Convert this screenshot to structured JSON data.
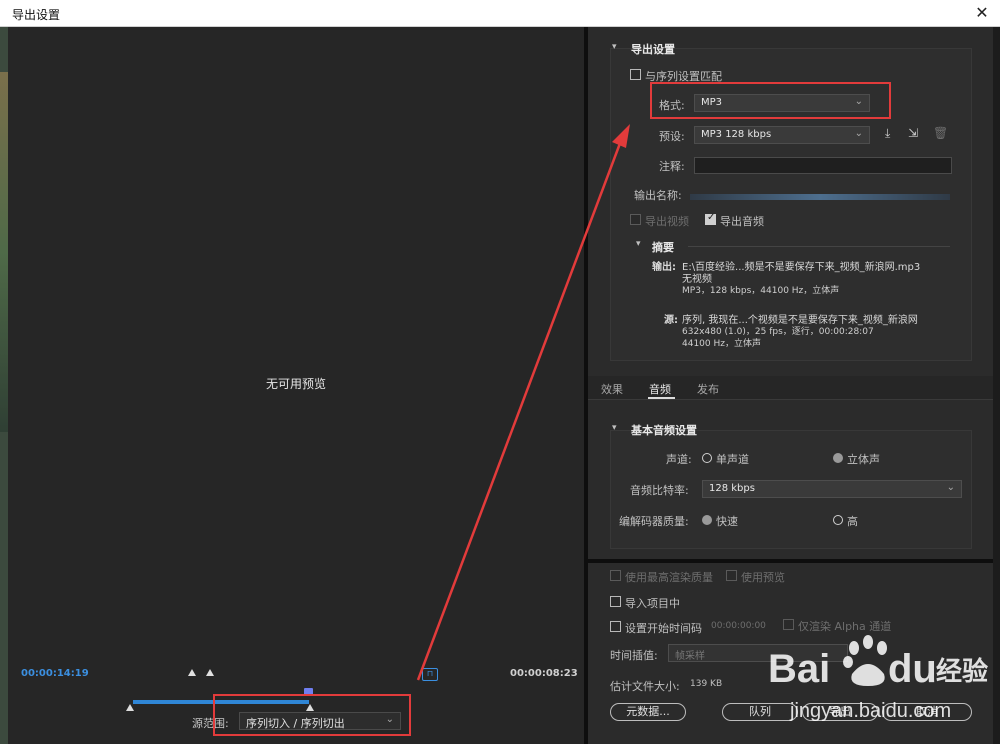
{
  "window": {
    "title": "导出设置",
    "close": "✕"
  },
  "preview": {
    "no_preview": "无可用预览",
    "timecode_in": "00:00:14:19",
    "timecode_out": "00:00:08:23",
    "source_range_label": "源范围:",
    "source_range_value": "序列切入 / 序列切出"
  },
  "export_settings": {
    "heading": "导出设置",
    "match_sequence": "与序列设置匹配",
    "format_label": "格式:",
    "format_value": "MP3",
    "preset_label": "预设:",
    "preset_value": "MP3 128 kbps",
    "comment_label": "注释:",
    "output_name_label": "输出名称:",
    "export_video": "导出视频",
    "export_audio": "导出音频",
    "export_video_checked": false,
    "export_audio_checked": true
  },
  "summary": {
    "heading": "摘要",
    "output_label": "输出:",
    "output_line1": "E:\\百度经验...频是不是要保存下来_视频_新浪网.mp3",
    "output_line2": "无视频",
    "output_line3": "MP3，128 kbps，44100 Hz，立体声",
    "source_label": "源:",
    "source_line1": "序列, 我现在...个视频是不是要保存下来_视频_新浪网",
    "source_line2": "632x480 (1.0)，25 fps，逐行，00:00:28:07",
    "source_line3": "44100 Hz，立体声"
  },
  "tabs": [
    "效果",
    "音频",
    "发布"
  ],
  "active_tab": "音频",
  "basic_audio": {
    "heading": "基本音频设置",
    "channels_label": "声道:",
    "mono": "单声道",
    "stereo": "立体声",
    "bitrate_label": "音频比特率:",
    "bitrate_value": "128 kbps",
    "codec_quality_label": "编解码器质量:",
    "fast": "快速",
    "high": "高"
  },
  "bottom": {
    "max_render": "使用最高渲染质量",
    "use_previews": "使用预览",
    "import_project": "导入项目中",
    "set_start_tc": "设置开始时间码",
    "start_tc_value": "00:00:00:00",
    "render_alpha": "仅渲染 Alpha 通道",
    "time_interp_label": "时间插值:",
    "time_interp_value": "帧采样",
    "file_size_label": "估计文件大小:",
    "file_size_value": "139 KB",
    "metadata_btn": "元数据...",
    "queue_btn": "队列",
    "export_btn": "导出",
    "cancel_btn": "取消"
  },
  "watermark": {
    "brand": "Baidu 经验",
    "url": "jingyan.baidu.com"
  },
  "colors": {
    "accent": "#3b8fe0",
    "highlight": "#e23b3b"
  }
}
